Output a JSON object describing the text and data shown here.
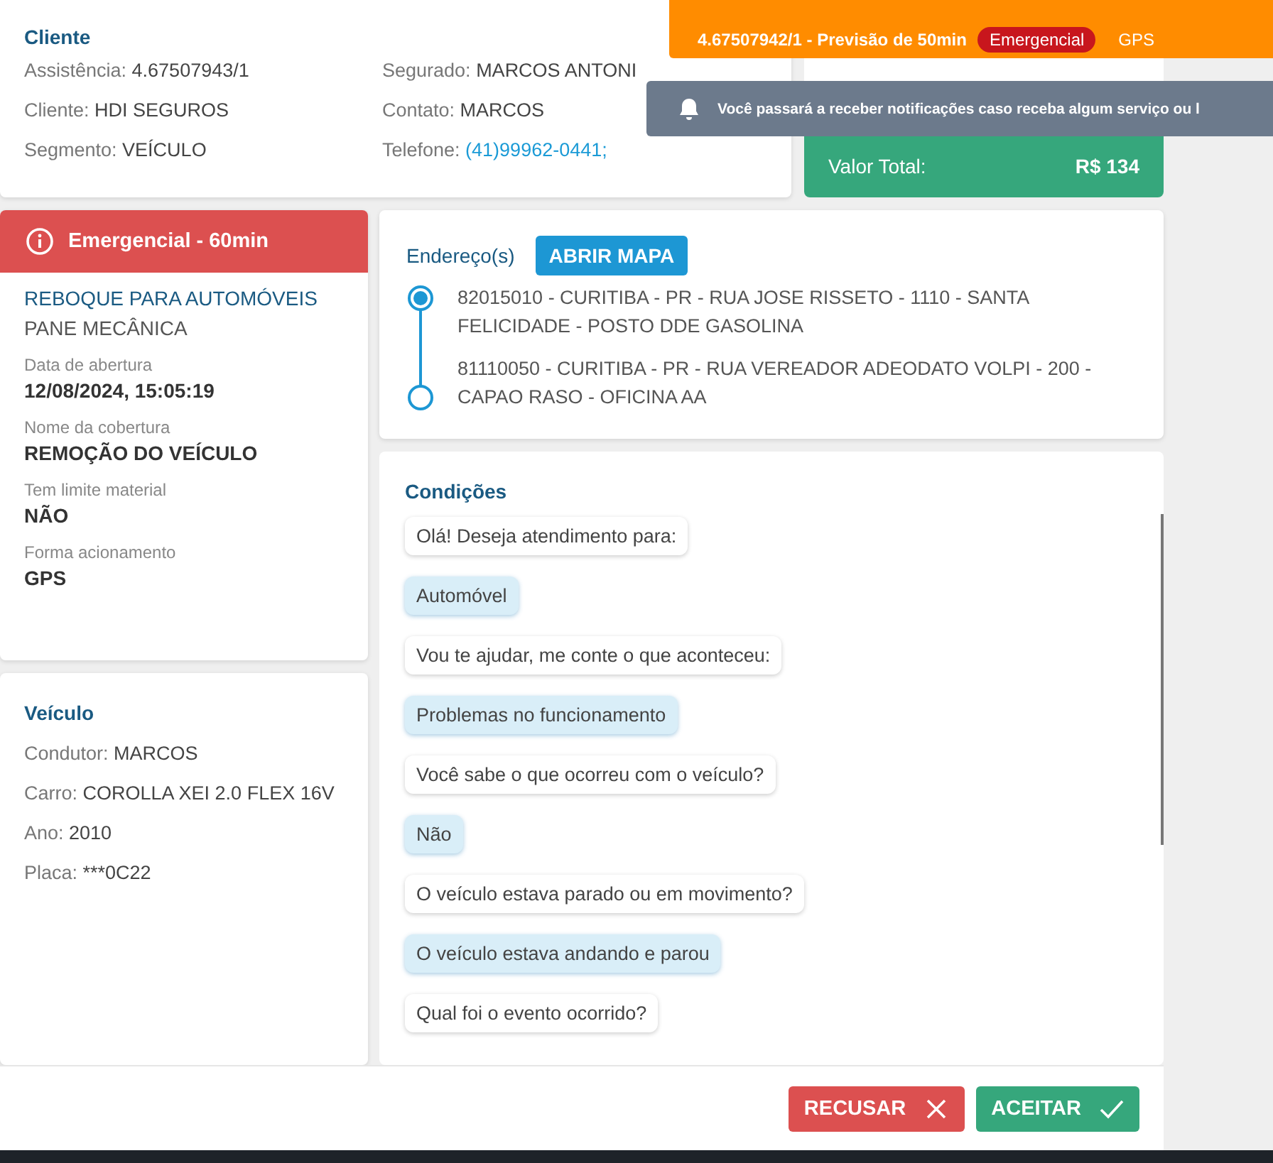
{
  "service_toast": {
    "subtitle": "4.67507942/1 - Previsão de 50min",
    "priority_badge": "Emergencial",
    "trigger": "GPS"
  },
  "notice_toast": {
    "text": "Você passará a receber notificações caso receba algum serviço ou l"
  },
  "client": {
    "title": "Cliente",
    "fields": [
      {
        "label": "Assistência:",
        "value": "4.67507943/1",
        "kind": "text"
      },
      {
        "label": "Cliente:",
        "value": "HDI SEGUROS",
        "kind": "text"
      },
      {
        "label": "Segmento:",
        "value": "VEÍCULO",
        "kind": "text"
      },
      {
        "label": "Segurado:",
        "value": "MARCOS ANTONI",
        "kind": "text"
      },
      {
        "label": "Contato:",
        "value": "MARCOS",
        "kind": "text"
      },
      {
        "label": "Telefone:",
        "value": "(41)99962-0441;",
        "kind": "link"
      }
    ]
  },
  "total": {
    "label": "Valor Total:",
    "value": "R$ 134"
  },
  "service": {
    "priority_banner": "Emergencial - 60min",
    "name": "REBOQUE PARA AUTOMÓVEIS",
    "reason": "PANE MECÂNICA",
    "details": [
      {
        "label": "Data de abertura",
        "value": "12/08/2024, 15:05:19"
      },
      {
        "label": "Nome da cobertura",
        "value": "REMOÇÃO DO VEÍCULO"
      },
      {
        "label": "Tem limite material",
        "value": "NÃO"
      },
      {
        "label": "Forma acionamento",
        "value": "GPS"
      }
    ]
  },
  "vehicle": {
    "title": "Veículo",
    "fields": [
      {
        "label": "Condutor:",
        "value": "MARCOS"
      },
      {
        "label": "Carro:",
        "value": "COROLLA XEI 2.0 FLEX 16V"
      },
      {
        "label": "Ano:",
        "value": "2010"
      },
      {
        "label": "Placa:",
        "value": "***0C22"
      }
    ]
  },
  "addresses": {
    "title": "Endereço(s)",
    "map_button": "ABRIR MAPA",
    "stops": [
      {
        "text": "82015010 - CURITIBA - PR - RUA JOSE RISSETO - 1110 - SANTA FELICIDADE - POSTO DDE GASOLINA",
        "kind": "origin"
      },
      {
        "text": "81110050 - CURITIBA - PR - RUA VEREADOR ADEODATO VOLPI - 200 - CAPAO RASO - OFICINA AA",
        "kind": "destination"
      }
    ]
  },
  "conditions": {
    "title": "Condições",
    "messages": [
      {
        "text": "Olá! Deseja atendimento para:",
        "kind": "question"
      },
      {
        "text": "Automóvel",
        "kind": "answer"
      },
      {
        "text": "Vou te ajudar, me conte o que aconteceu:",
        "kind": "question"
      },
      {
        "text": "Problemas no funcionamento",
        "kind": "answer"
      },
      {
        "text": "Você sabe o que ocorreu com o veículo?",
        "kind": "question"
      },
      {
        "text": "Não",
        "kind": "answer"
      },
      {
        "text": "O veículo estava parado ou em movimento?",
        "kind": "question"
      },
      {
        "text": "O veículo estava andando e parou",
        "kind": "answer"
      },
      {
        "text": "Qual foi o evento ocorrido?",
        "kind": "question"
      }
    ]
  },
  "actions": [
    {
      "label": "RECUSAR",
      "kind": "reject"
    },
    {
      "label": "ACEITAR",
      "kind": "accept"
    }
  ]
}
